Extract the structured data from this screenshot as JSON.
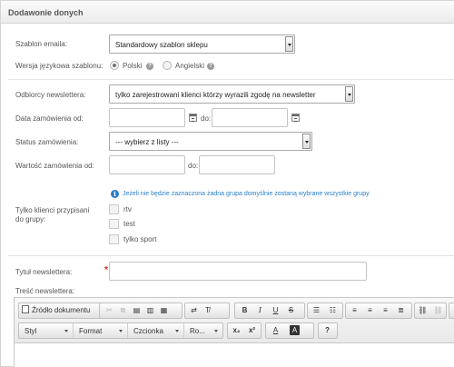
{
  "panel": {
    "title": "Dodawonie donych"
  },
  "template": {
    "label": "Szablon emaila:",
    "value": "Standardowy szablon sklepu"
  },
  "language": {
    "label": "Wersja językowa szablonu:",
    "options": [
      {
        "label": "Polski",
        "checked": true
      },
      {
        "label": "Angielski",
        "checked": false
      }
    ],
    "help_icon": "question-icon"
  },
  "recipients": {
    "label": "Odbiorcy newslettera:",
    "value": "tylko zarejestrowani klienci którzy wyrazili zgodę na newsletter"
  },
  "order_date": {
    "label": "Data zamówienia od:",
    "to_label": "do:",
    "from_value": "",
    "to_value": ""
  },
  "order_status": {
    "label": "Status zamówienia:",
    "value": "--- wybierz z listy ---"
  },
  "order_value": {
    "label": "Wartość zamówienia od:",
    "to_label": "do:",
    "from_value": "",
    "to_value": ""
  },
  "groups": {
    "info": "Jeżeli nie będzie zaznaczona żadna grupa domyślnie zostaną wybrane wszystkie grupy",
    "label_line1": "Tylko klienci przypisani",
    "label_line2": "do grupy:",
    "options": [
      {
        "label": "rtv",
        "checked": false
      },
      {
        "label": "test",
        "checked": false
      },
      {
        "label": "tylko sport",
        "checked": false
      }
    ]
  },
  "title_field": {
    "label": "Tytuł newslettera:",
    "value": "",
    "required_mark": "*"
  },
  "content": {
    "label": "Treść newslettera:",
    "toolbar": {
      "source_label": "Źródło dokumentu",
      "style_label": "Styl",
      "format_label": "Format",
      "font_label": "Czcionka",
      "size_label": "Ro...",
      "bold": "B",
      "italic": "I",
      "underline": "U",
      "strike": "S",
      "subscript": "x₂",
      "superscript": "x²",
      "text_color": "A",
      "bg_color": "A",
      "help": "?"
    }
  },
  "colors": {
    "accent": "#2b7fc8",
    "required": "#d9261c"
  }
}
